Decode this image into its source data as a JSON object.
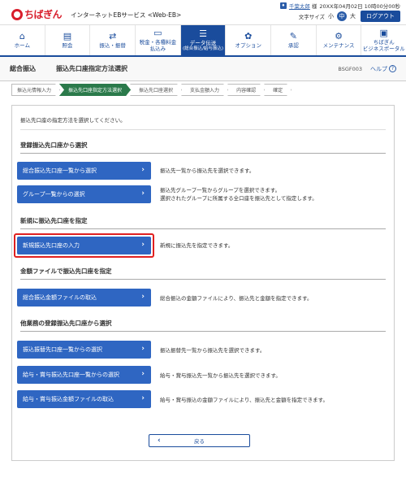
{
  "header": {
    "logo": "ちばぎん",
    "service": "インターネットEBサービス <Web-EB>",
    "user_name": "千葉太郎",
    "user_suffix": "様",
    "datetime": "20XX年04月02日 10時00分00秒",
    "font_size_label": "文字サイズ",
    "font_small": "小",
    "font_mid": "中",
    "font_large": "大",
    "logout": "ログアウト"
  },
  "nav": {
    "home": "ホーム",
    "inquiry": "照会",
    "transfer": "振込・振替",
    "taxes_line1": "税金・各種料金",
    "taxes_line2": "払込み",
    "data_line1": "データ伝送",
    "data_line2": "(総合振込/給与振込)",
    "option": "オプション",
    "approval": "承認",
    "maintenance": "メンテナンス",
    "portal_line1": "ちばぎん",
    "portal_line2": "ビジネスポータル"
  },
  "title": {
    "main": "総合振込",
    "sub": "振込先口座指定方法選択",
    "screen_id": "BSGF003",
    "help": "ヘルプ"
  },
  "steps": [
    "振込元情報入力",
    "振込先口座指定方法選択",
    "振込先口座選択",
    "支払金額入力",
    "内容確認",
    "確定"
  ],
  "intro": "振込先口座の指定方法を選択してください。",
  "sections": {
    "registered": "登録振込先口座から選択",
    "new": "新規に振込先口座を指定",
    "file": "金額ファイルで振込先口座を指定",
    "other": "他業務の登録振込先口座から選択"
  },
  "buttons": {
    "b1": "総合振込先口座一覧から選択",
    "b1_desc": "振込先一覧から振込先を選択できます。",
    "b2": "グループ一覧からの選択",
    "b2_desc1": "振込先グループ一覧からグループを選択できます。",
    "b2_desc2": "選択されたグループに所属する全口座を振込先として指定します。",
    "b3": "新規振込先口座の入力",
    "b3_desc": "新規に振込先を指定できます。",
    "b4": "総合振込金額ファイルの取込",
    "b4_desc": "総合振込の金額ファイルにより、振込先と金額を指定できます。",
    "b5": "振込振替先口座一覧からの選択",
    "b5_desc": "振込振替先一覧から振込先を選択できます。",
    "b6": "給与・賞与振込先口座一覧からの選択",
    "b6_desc": "給与・賞与振込先一覧から振込先を選択できます。",
    "b7": "給与・賞与振込金額ファイルの取込",
    "b7_desc": "給与・賞与振込の金額ファイルにより、振込先と金額を指定できます。",
    "back": "戻る"
  },
  "colors": {
    "primary": "#1a4c9c",
    "button": "#2f66c2",
    "step_current": "#2b7a4b",
    "brand": "#d81e2c",
    "highlight": "#e02020"
  }
}
